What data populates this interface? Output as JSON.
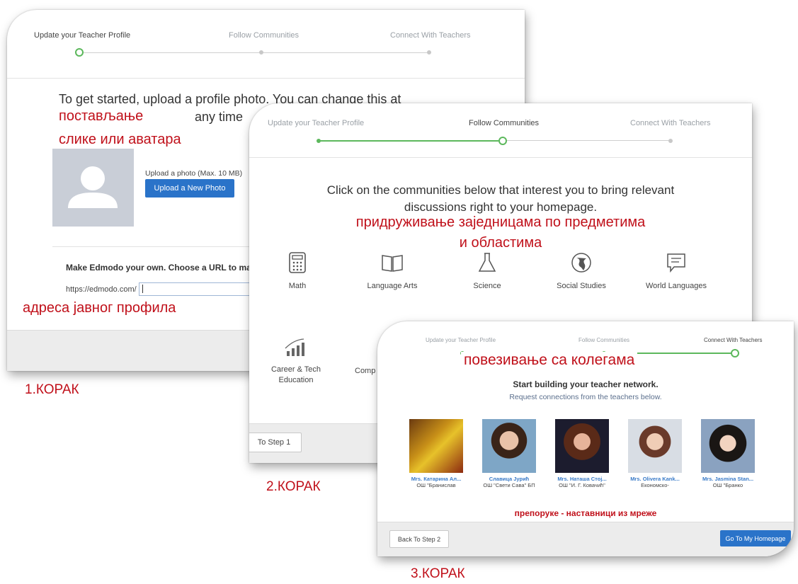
{
  "steps": {
    "s1": "Update your Teacher Profile",
    "s2": "Follow Communities",
    "s3": "Connect With Teachers"
  },
  "card1": {
    "intro_line1": "To get started, upload a profile photo. You can change this at",
    "intro_line2": "any time",
    "upload_hint": "Upload a photo (Max. 10 MB)",
    "upload_button": "Upload a New Photo",
    "url_heading": "Make Edmodo your own. Choose a URL to ma",
    "url_prefix": "https://edmodo.com/",
    "url_value": "",
    "note_photo_1": "постављање",
    "note_photo_2": "слике или аватара",
    "note_url": "адреса јавног профила"
  },
  "card2": {
    "intro_line1": "Click on the communities below that interest you to bring relevant",
    "intro_line2": "discussions right to your homepage.",
    "note_line1": "придруживање заједницама по предметима",
    "note_line2": "и областима",
    "communities": [
      "Math",
      "Language Arts",
      "Science",
      "Social Studies",
      "World Languages"
    ],
    "community_career_1": "Career & Tech",
    "community_career_2": "Education",
    "community_comp": "Comp",
    "back_button": "To Step 1"
  },
  "card3": {
    "note": "повезивање са колегама",
    "heading": "Start building your teacher network.",
    "subheading": "Request connections from the teachers below.",
    "teachers": [
      {
        "name": "Mrs. Катарина Ал...",
        "school": "ОШ \"Бранислав"
      },
      {
        "name": "Славица Јурић",
        "school": "ОШ \"Свети Сава\" БП"
      },
      {
        "name": "Mrs. Наташа Стој...",
        "school": "ОШ \"И. Г. Ковачић\""
      },
      {
        "name": "Mrs. Olivera Kank...",
        "school": "Економско-"
      },
      {
        "name": "Mrs. Jasmina Stan...",
        "school": "ОШ \"Бранко"
      }
    ],
    "recommend_note": "препоруке - наставници из мреже",
    "back_button": "Back To Step 2",
    "home_button": "Go To My Homepage"
  },
  "labels": {
    "step1": "1.КОРАК",
    "step2": "2.КОРАК",
    "step3": "3.КОРАК"
  },
  "colors": {
    "accent_green": "#5cb85c",
    "primary_blue": "#2a73c9",
    "note_red": "#c0101a",
    "link_blue": "#3a7bc8"
  },
  "icons": {
    "math": "calculator-icon",
    "language_arts": "book-icon",
    "science": "flask-icon",
    "social_studies": "globe-icon",
    "world_languages": "speech-bubble-icon",
    "career": "bar-chart-icon",
    "avatar": "user-silhouette-icon"
  }
}
